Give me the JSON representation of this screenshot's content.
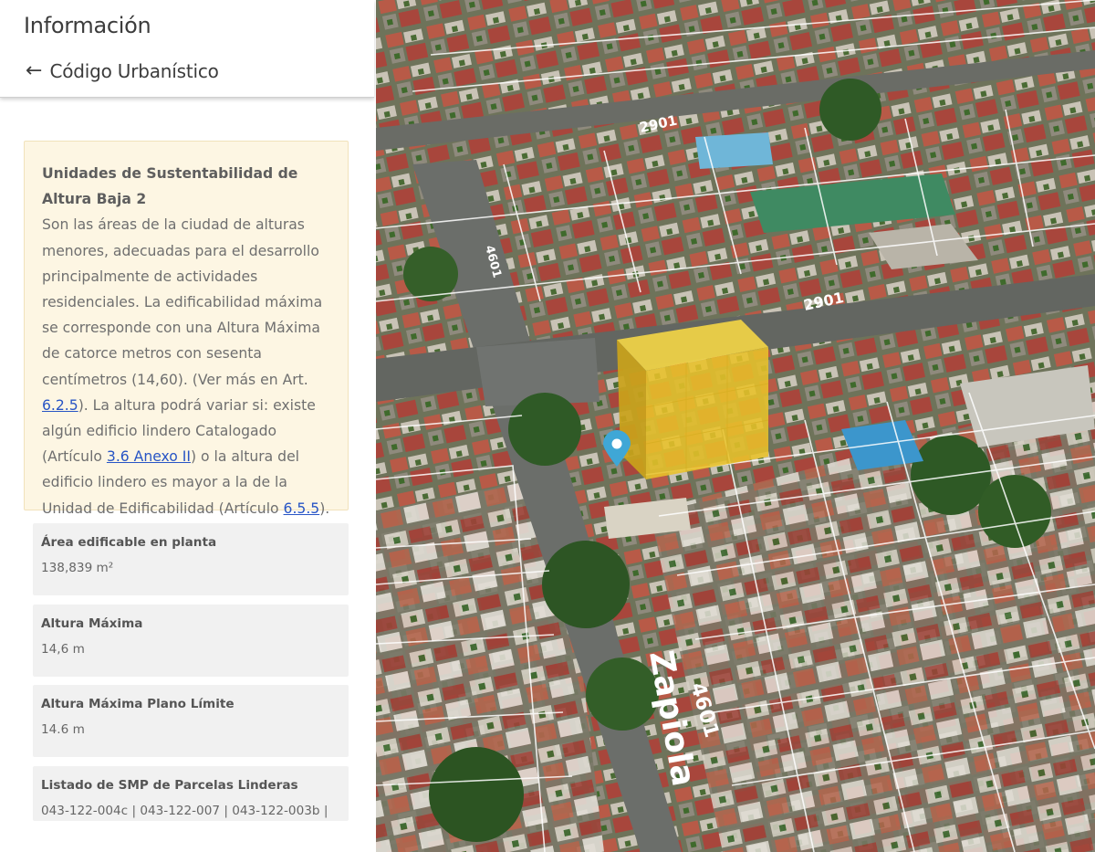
{
  "panel": {
    "title": "Información",
    "back_label": "Código Urbanístico",
    "info": {
      "title": "Unidades de Sustentabilidad de Altura Baja 2",
      "text_1": "Son las áreas de la ciudad de alturas menores, adecuadas para el desarrollo principalmente de actividades residenciales. La edificabilidad máxima se corresponde con una Altura Máxima de catorce metros con sesenta centímetros (14,60). (Ver más en Art. ",
      "link_1": "6.2.5",
      "text_2": "). La altura podrá variar si: existe algún edificio lindero Catalogado (Artículo ",
      "link_2": "3.6 Anexo II",
      "text_3": ") o la altura del edificio lindero es mayor a la de la Unidad de Edificabilidad (Artículo ",
      "link_3": "6.5.5",
      "text_4": ")."
    },
    "cards": [
      {
        "label": "Área edificable en planta",
        "value": "138,839 m²"
      },
      {
        "label": "Altura Máxima",
        "value": "14,6 m"
      },
      {
        "label": "Altura Máxima Plano Límite",
        "value": "14.6 m"
      },
      {
        "label": "Listado de SMP de Parcelas Linderas",
        "value": "043-122-004c | 043-122-007 | 043-122-003b |"
      }
    ]
  },
  "map": {
    "street_labels": [
      "2901",
      "2901",
      "4601",
      "Zapiola",
      "4601"
    ],
    "colors": {
      "volume": "#e8c22a",
      "marker": "#3fa7d6"
    }
  }
}
